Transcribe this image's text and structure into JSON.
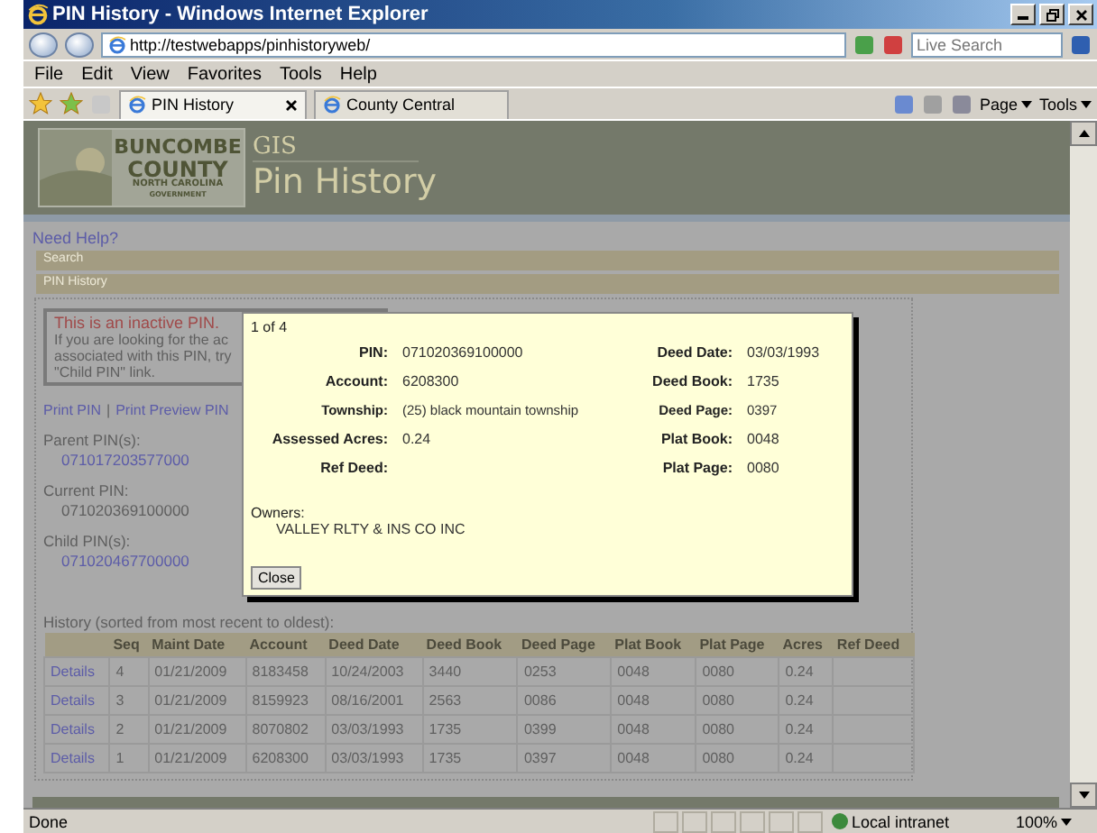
{
  "window": {
    "title": "PIN History - Windows Internet Explorer"
  },
  "address_bar": {
    "url": "http://testwebapps/pinhistoryweb/",
    "search_placeholder": "Live Search"
  },
  "menu": [
    "File",
    "Edit",
    "View",
    "Favorites",
    "Tools",
    "Help"
  ],
  "tabs": [
    {
      "label": "PIN History",
      "selected": true
    },
    {
      "label": "County Central",
      "selected": false
    }
  ],
  "command_bar": [
    "Page",
    "Tools"
  ],
  "banner": {
    "logo_lines": [
      "BUNCOMBE",
      "COUNTY",
      "NORTH CAROLINA",
      "GOVERNMENT"
    ],
    "kicker": "GIS",
    "title": "Pin History"
  },
  "page": {
    "help_link": "Need Help?",
    "section_bars": [
      "Search",
      "PIN History"
    ],
    "notice": {
      "title": "This is an inactive PIN.",
      "lines": [
        "If you are looking for the ac",
        "associated with this PIN, try",
        "\"Child PIN\" link."
      ]
    },
    "print_links": [
      "Print PIN",
      "Print Preview PIN"
    ],
    "print_separator": "|",
    "pin_groups": [
      {
        "label": "Parent PIN(s):",
        "value": "071017203577000",
        "link": true
      },
      {
        "label": "Current PIN:",
        "value": "071020369100000",
        "link": false
      },
      {
        "label": "Child PIN(s):",
        "value": "071020467700000",
        "link": true
      }
    ],
    "history_caption": "History (sorted from most recent to oldest):",
    "table": {
      "columns": [
        "",
        "Seq",
        "Maint Date",
        "Account",
        "Deed Date",
        "Deed Book",
        "Deed Page",
        "Plat Book",
        "Plat Page",
        "Acres",
        "Ref Deed"
      ],
      "rows": [
        [
          "Details",
          "4",
          "01/21/2009",
          "8183458",
          "10/24/2003",
          "3440",
          "0253",
          "0048",
          "0080",
          "0.24",
          ""
        ],
        [
          "Details",
          "3",
          "01/21/2009",
          "8159923",
          "08/16/2001",
          "2563",
          "0086",
          "0048",
          "0080",
          "0.24",
          ""
        ],
        [
          "Details",
          "2",
          "01/21/2009",
          "8070802",
          "03/03/1993",
          "1735",
          "0399",
          "0048",
          "0080",
          "0.24",
          ""
        ],
        [
          "Details",
          "1",
          "01/21/2009",
          "6208300",
          "03/03/1993",
          "1735",
          "0397",
          "0048",
          "0080",
          "0.24",
          ""
        ]
      ]
    }
  },
  "dialog": {
    "counter": "1 of 4",
    "fields": [
      [
        {
          "label": "PIN:",
          "value": "071020369100000"
        },
        {
          "label": "Deed Date:",
          "value": "03/03/1993"
        }
      ],
      [
        {
          "label": "Account:",
          "value": "6208300"
        },
        {
          "label": "Deed Book:",
          "value": "1735"
        }
      ],
      [
        {
          "label": "Township:",
          "value": "(25) black mountain township"
        },
        {
          "label": "Deed Page:",
          "value": "0397"
        }
      ],
      [
        {
          "label": "Assessed Acres:",
          "value": "0.24"
        },
        {
          "label": "Plat Book:",
          "value": "0048"
        }
      ],
      [
        {
          "label": "Ref Deed:"
        },
        {
          "label": "Plat Page:",
          "value": "0080"
        }
      ]
    ],
    "owners_label": "Owners:",
    "owners": [
      "VALLEY RLTY & INS CO INC"
    ],
    "close": "Close"
  },
  "status_bar": {
    "text": "Done",
    "zone": "Local intranet",
    "zoom": "100%"
  }
}
